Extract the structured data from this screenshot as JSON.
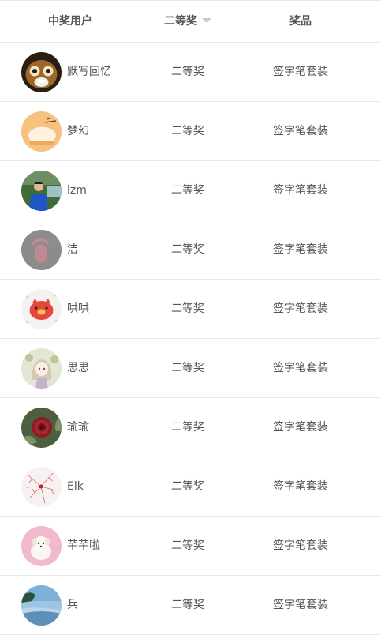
{
  "table": {
    "headers": {
      "user": "中奖用户",
      "prize": "二等奖",
      "gift": "奖品"
    },
    "sort_icon": "triangle-down-icon",
    "rows": [
      {
        "name": "默写回忆",
        "prize": "二等奖",
        "gift": "签字笔套装",
        "avatar": "cartoon-character-avatar"
      },
      {
        "name": "梦幻",
        "prize": "二等奖",
        "gift": "签字笔套装",
        "avatar": "cake-avatar"
      },
      {
        "name": "lzm",
        "prize": "二等奖",
        "gift": "签字笔套装",
        "avatar": "person-outdoors-avatar"
      },
      {
        "name": "洁",
        "prize": "二等奖",
        "gift": "签字笔套装",
        "avatar": "footprint-avatar"
      },
      {
        "name": "哄哄",
        "prize": "二等奖",
        "gift": "签字笔套装",
        "avatar": "red-pig-avatar"
      },
      {
        "name": "思思",
        "prize": "二等奖",
        "gift": "签字笔套装",
        "avatar": "anime-girl-avatar"
      },
      {
        "name": "瑜瑜",
        "prize": "二等奖",
        "gift": "签字笔套装",
        "avatar": "red-flower-avatar"
      },
      {
        "name": "Elk",
        "prize": "二等奖",
        "gift": "签字笔套装",
        "avatar": "red-branches-avatar"
      },
      {
        "name": "芊芊啦",
        "prize": "二等奖",
        "gift": "签字笔套装",
        "avatar": "white-puppy-avatar"
      },
      {
        "name": "兵",
        "prize": "二等奖",
        "gift": "签字笔套装",
        "avatar": "sky-landscape-avatar"
      }
    ]
  }
}
